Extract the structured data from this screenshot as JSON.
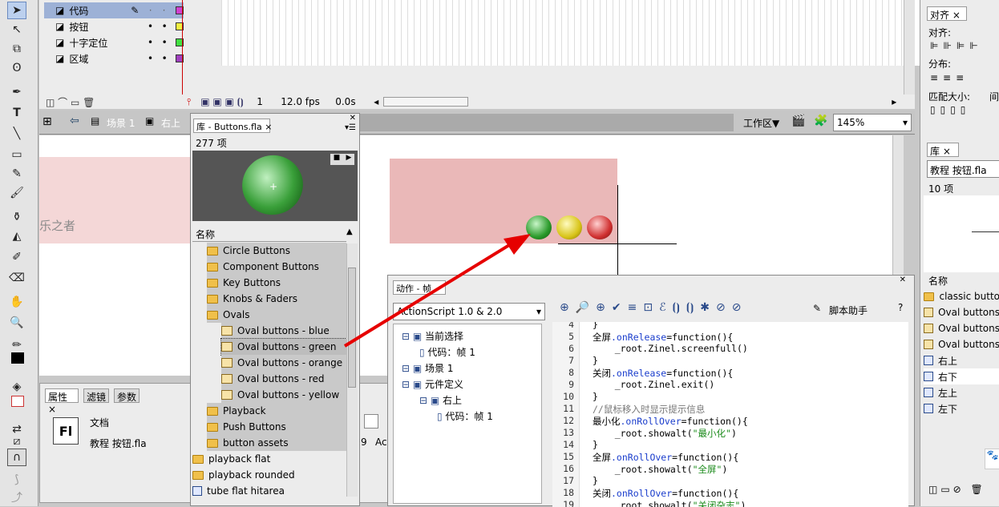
{
  "timeline": {
    "layers": [
      {
        "name": "代码",
        "color": "#d040d0"
      },
      {
        "name": "按钮",
        "color": "#f0f040"
      },
      {
        "name": "十字定位",
        "color": "#40e040"
      },
      {
        "name": "区域",
        "color": "#a040c0"
      }
    ],
    "frame_number": "1",
    "fps": "12.0 fps",
    "time": "0.0s"
  },
  "editbar": {
    "scene": "场景 1",
    "symbol": "右上",
    "workspace": "工作区▼",
    "zoom": "145%"
  },
  "stage": {
    "watermark_text": "乐之者"
  },
  "library_buttons": {
    "tab_title": "库 - Buttons.fla",
    "count": "277 项",
    "column_name": "名称",
    "items": [
      {
        "label": "Circle Buttons",
        "type": "folder"
      },
      {
        "label": "Component Buttons",
        "type": "folder"
      },
      {
        "label": "Key Buttons",
        "type": "folder"
      },
      {
        "label": "Knobs & Faders",
        "type": "folder"
      },
      {
        "label": "Ovals",
        "type": "folder-open"
      },
      {
        "label": "Oval buttons - blue",
        "type": "button"
      },
      {
        "label": "Oval buttons - green",
        "type": "button"
      },
      {
        "label": "Oval buttons - orange",
        "type": "button"
      },
      {
        "label": "Oval buttons - red",
        "type": "button"
      },
      {
        "label": "Oval buttons - yellow",
        "type": "button"
      },
      {
        "label": "Playback",
        "type": "folder"
      },
      {
        "label": "Push Buttons",
        "type": "folder"
      },
      {
        "label": "button assets",
        "type": "folder"
      },
      {
        "label": "playback flat",
        "type": "folder"
      },
      {
        "label": "playback rounded",
        "type": "folder"
      },
      {
        "label": "tube flat hitarea",
        "type": "symbol"
      }
    ]
  },
  "properties": {
    "tabs": [
      "属性",
      "滤镜",
      "参数"
    ],
    "doc_label": "文档",
    "doc_name": "教程 按钮.fla",
    "fl_icon": "Fl",
    "partial_9": "9",
    "partial_act": "Act"
  },
  "actions": {
    "tab_title": "动作 - 帧",
    "language": "ActionScript 1.0 & 2.0",
    "script_assist": "脚本助手",
    "tree": [
      {
        "label": "当前选择",
        "indent": 0
      },
      {
        "label": "代码：帧 1",
        "indent": 1
      },
      {
        "label": "场景 1",
        "indent": 0
      },
      {
        "label": "元件定义",
        "indent": 0
      },
      {
        "label": "右上",
        "indent": 1
      },
      {
        "label": "代码：帧 1",
        "indent": 2
      }
    ],
    "code_lines": [
      {
        "n": "4",
        "t": "}"
      },
      {
        "n": "5",
        "t": "全屏.onRelease=function(){"
      },
      {
        "n": "6",
        "t": "    _root.Zinel.screenfull()"
      },
      {
        "n": "7",
        "t": "}"
      },
      {
        "n": "8",
        "t": "关闭.onRelease=function(){"
      },
      {
        "n": "9",
        "t": "    _root.Zinel.exit()"
      },
      {
        "n": "10",
        "t": "}"
      },
      {
        "n": "11",
        "t": "//鼠标移入时显示提示信息"
      },
      {
        "n": "12",
        "t": "最小化.onRollOver=function(){"
      },
      {
        "n": "13",
        "t": "    _root.showalt(\"最小化\")"
      },
      {
        "n": "14",
        "t": "}"
      },
      {
        "n": "15",
        "t": "全屏.onRollOver=function(){"
      },
      {
        "n": "16",
        "t": "    _root.showalt(\"全屏\")"
      },
      {
        "n": "17",
        "t": "}"
      },
      {
        "n": "18",
        "t": "关闭.onRollOver=function(){"
      },
      {
        "n": "19",
        "t": "    _root.showalt(\"关闭杂志\")"
      }
    ]
  },
  "align_panel": {
    "tab_title": "对齐",
    "align_label": "对齐:",
    "distribute_label": "分布:",
    "match_size_label": "匹配大小:",
    "space_label": "间"
  },
  "right_library": {
    "tab_title": "库",
    "file": "教程 按钮.fla",
    "count": "10 项",
    "column_name": "名称",
    "items": [
      {
        "label": "classic butto",
        "type": "folder"
      },
      {
        "label": "Oval buttons",
        "type": "button"
      },
      {
        "label": "Oval buttons",
        "type": "button"
      },
      {
        "label": "Oval buttons",
        "type": "button"
      },
      {
        "label": "右上",
        "type": "symbol"
      },
      {
        "label": "右下",
        "type": "symbol"
      },
      {
        "label": "左上",
        "type": "symbol"
      },
      {
        "label": "左下",
        "type": "symbol"
      }
    ]
  }
}
